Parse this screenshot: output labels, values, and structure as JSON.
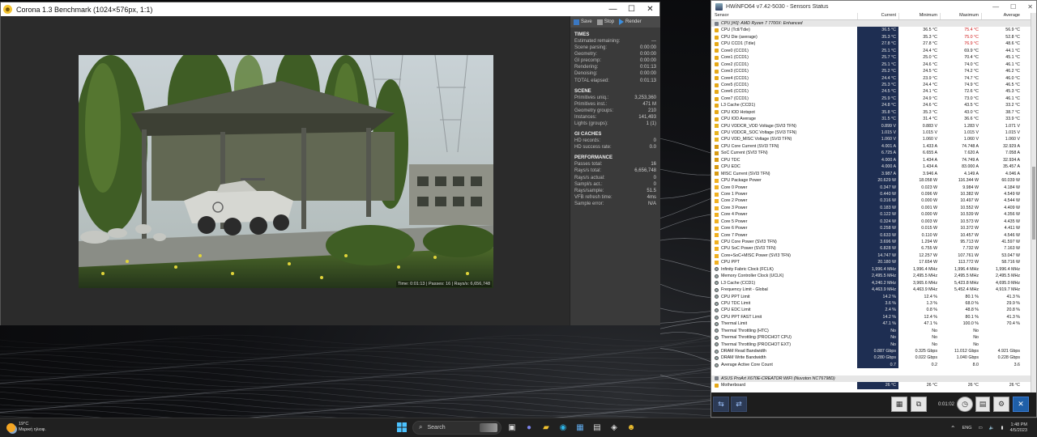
{
  "corona": {
    "title": "Corona 1.3 Benchmark (1024×576px, 1:1)",
    "controls": {
      "min": "—",
      "max": "☐",
      "close": "✕"
    },
    "toolbar": {
      "save": "Save",
      "stop": "Stop",
      "render": "Render"
    },
    "status_overlay": "Time: 0:01:13 | Passes: 16 | Rays/s: 6,656,748",
    "sections": [
      {
        "title": "TIMES",
        "rows": [
          [
            "Estimated remaining:",
            "---"
          ],
          [
            "Scene parsing:",
            "0:00:00"
          ],
          [
            "Geometry:",
            "0:00:00"
          ],
          [
            "GI precomp:",
            "0:00:00"
          ],
          [
            "Rendering:",
            "0:01:13"
          ],
          [
            "Denoising:",
            "0:00:00"
          ],
          [
            "TOTAL elapsed:",
            "0:01:13"
          ]
        ]
      },
      {
        "title": "SCENE",
        "rows": [
          [
            "Primitives uniq.:",
            "3,253,360"
          ],
          [
            "Primitives inst.:",
            "471 M"
          ],
          [
            "Geometry groups:",
            "210"
          ],
          [
            "Instances:",
            "141,493"
          ],
          [
            "Lights (groups):",
            "1 (1)"
          ]
        ]
      },
      {
        "title": "GI CACHES",
        "rows": [
          [
            "HD records:",
            "0"
          ],
          [
            "HD success rate:",
            "0.0"
          ]
        ]
      },
      {
        "title": "PERFORMANCE",
        "rows": [
          [
            "Passes total:",
            "16"
          ],
          [
            "Rays/s total:",
            "6,656,748"
          ],
          [
            "Rays/s actual:",
            "0"
          ],
          [
            "Sampl/s act.:",
            "0"
          ],
          [
            "Rays/sample:",
            "51.5"
          ],
          [
            "VFB refresh time:",
            "4ms"
          ],
          [
            "Sample error:",
            "N/A"
          ]
        ]
      }
    ]
  },
  "hwinfo": {
    "title": "HWiNFO64 v7.42-5030 - Sensors Status",
    "columns": {
      "sensor": "Sensor",
      "current": "Current",
      "minimum": "Minimum",
      "maximum": "Maximum",
      "average": "Average"
    },
    "timer": "0:01:02",
    "rows": [
      {
        "type": "group",
        "name": "CPU [#0]: AMD Ryzen 7 7700X: Enhanced"
      },
      {
        "i": "t",
        "name": "CPU (Tctl/Tdie)",
        "cur": "36.5 °C",
        "min": "36.5 °C",
        "max": "75.4 °C",
        "avg": "56.9 °C",
        "maxred": true
      },
      {
        "i": "t",
        "name": "CPU Die (average)",
        "cur": "35.3 °C",
        "min": "35.3 °C",
        "max": "75.0 °C",
        "avg": "52.8 °C",
        "maxred": true
      },
      {
        "i": "t",
        "name": "CPU CCD1 (Tdie)",
        "cur": "27.8 °C",
        "min": "27.8 °C",
        "max": "76.9 °C",
        "avg": "48.6 °C",
        "maxred": true
      },
      {
        "i": "t",
        "name": "Core0 (CCD1)",
        "cur": "25.1 °C",
        "min": "24.4 °C",
        "max": "69.9 °C",
        "avg": "44.1 °C"
      },
      {
        "i": "t",
        "name": "Core1 (CCD1)",
        "cur": "25.7 °C",
        "min": "25.0 °C",
        "max": "70.4 °C",
        "avg": "45.1 °C"
      },
      {
        "i": "t",
        "name": "Core2 (CCD1)",
        "cur": "25.1 °C",
        "min": "24.6 °C",
        "max": "74.0 °C",
        "avg": "46.1 °C"
      },
      {
        "i": "t",
        "name": "Core3 (CCD1)",
        "cur": "25.2 °C",
        "min": "24.5 °C",
        "max": "74.2 °C",
        "avg": "46.2 °C"
      },
      {
        "i": "t",
        "name": "Core4 (CCD1)",
        "cur": "24.4 °C",
        "min": "23.9 °C",
        "max": "74.7 °C",
        "avg": "46.0 °C"
      },
      {
        "i": "t",
        "name": "Core5 (CCD1)",
        "cur": "25.3 °C",
        "min": "24.4 °C",
        "max": "74.9 °C",
        "avg": "46.5 °C"
      },
      {
        "i": "t",
        "name": "Core6 (CCD1)",
        "cur": "24.5 °C",
        "min": "24.1 °C",
        "max": "72.6 °C",
        "avg": "45.3 °C"
      },
      {
        "i": "t",
        "name": "Core7 (CCD1)",
        "cur": "25.9 °C",
        "min": "24.9 °C",
        "max": "73.0 °C",
        "avg": "46.1 °C"
      },
      {
        "i": "t",
        "name": "L3 Cache (CCD1)",
        "cur": "24.8 °C",
        "min": "24.6 °C",
        "max": "43.5 °C",
        "avg": "33.2 °C"
      },
      {
        "i": "t",
        "name": "CPU IOD Hotspot",
        "cur": "35.8 °C",
        "min": "35.3 °C",
        "max": "43.0 °C",
        "avg": "38.7 °C"
      },
      {
        "i": "t",
        "name": "CPU IOD Average",
        "cur": "31.5 °C",
        "min": "31.4 °C",
        "max": "36.6 °C",
        "avg": "33.9 °C"
      },
      {
        "i": "v",
        "name": "CPU VDDCR_VDD Voltage (SVI3 TFN)",
        "cur": "0.899 V",
        "min": "0.883 V",
        "max": "1.283 V",
        "avg": "1.071 V"
      },
      {
        "i": "v",
        "name": "CPU VDDCR_SOC Voltage (SVI3 TFN)",
        "cur": "1.015 V",
        "min": "1.015 V",
        "max": "1.015 V",
        "avg": "1.015 V"
      },
      {
        "i": "v",
        "name": "CPU VDD_MISC Voltage (SVI3 TFN)",
        "cur": "1.060 V",
        "min": "1.060 V",
        "max": "1.060 V",
        "avg": "1.060 V"
      },
      {
        "i": "c",
        "name": "CPU Core Current (SVI3 TFN)",
        "cur": "4.001 A",
        "min": "1.433 A",
        "max": "74.748 A",
        "avg": "32.929 A"
      },
      {
        "i": "c",
        "name": "SoC Current (SVI3 TFN)",
        "cur": "6.725 A",
        "min": "6.655 A",
        "max": "7.620 A",
        "avg": "7.058 A"
      },
      {
        "i": "c",
        "name": "CPU TDC",
        "cur": "4.000 A",
        "min": "1.434 A",
        "max": "74.749 A",
        "avg": "32.934 A"
      },
      {
        "i": "c",
        "name": "CPU EDC",
        "cur": "4.000 A",
        "min": "1.434 A",
        "max": "83.000 A",
        "avg": "35.457 A"
      },
      {
        "i": "c",
        "name": "MISC Current (SVI3 TFN)",
        "cur": "3.987 A",
        "min": "3.946 A",
        "max": "4.149 A",
        "avg": "4.046 A"
      },
      {
        "i": "p",
        "name": "CPU Package Power",
        "cur": "20.629 W",
        "min": "18.058 W",
        "max": "116.344 W",
        "avg": "60.039 W"
      },
      {
        "i": "p",
        "name": "Core 0 Power",
        "cur": "0.347 W",
        "min": "0.023 W",
        "max": "9.984 W",
        "avg": "4.184 W"
      },
      {
        "i": "p",
        "name": "Core 1 Power",
        "cur": "0.440 W",
        "min": "0.096 W",
        "max": "10.382 W",
        "avg": "4.549 W"
      },
      {
        "i": "p",
        "name": "Core 2 Power",
        "cur": "0.316 W",
        "min": "0.000 W",
        "max": "10.497 W",
        "avg": "4.544 W"
      },
      {
        "i": "p",
        "name": "Core 3 Power",
        "cur": "0.183 W",
        "min": "0.001 W",
        "max": "10.552 W",
        "avg": "4.409 W"
      },
      {
        "i": "p",
        "name": "Core 4 Power",
        "cur": "0.122 W",
        "min": "0.000 W",
        "max": "10.539 W",
        "avg": "4.356 W"
      },
      {
        "i": "p",
        "name": "Core 5 Power",
        "cur": "0.324 W",
        "min": "0.003 W",
        "max": "10.573 W",
        "avg": "4.435 W"
      },
      {
        "i": "p",
        "name": "Core 6 Power",
        "cur": "0.258 W",
        "min": "0.015 W",
        "max": "10.372 W",
        "avg": "4.411 W"
      },
      {
        "i": "p",
        "name": "Core 7 Power",
        "cur": "0.633 W",
        "min": "0.110 W",
        "max": "10.457 W",
        "avg": "4.546 W"
      },
      {
        "i": "p",
        "name": "CPU Core Power (SVI3 TFN)",
        "cur": "3.696 W",
        "min": "1.294 W",
        "max": "95.713 W",
        "avg": "41.597 W"
      },
      {
        "i": "p",
        "name": "CPU SoC Power (SVI3 TFN)",
        "cur": "6.828 W",
        "min": "6.755 W",
        "max": "7.732 W",
        "avg": "7.163 W"
      },
      {
        "i": "p",
        "name": "Core+SoC+MISC Power (SVI3 TFN)",
        "cur": "14.747 W",
        "min": "12.257 W",
        "max": "107.761 W",
        "avg": "53.047 W"
      },
      {
        "i": "p",
        "name": "CPU PPT",
        "cur": "20.180 W",
        "min": "17.654 W",
        "max": "113.772 W",
        "avg": "58.716 W"
      },
      {
        "i": "o",
        "name": "Infinity Fabric Clock (FCLK)",
        "cur": "1,996.4 MHz",
        "min": "1,996.4 MHz",
        "max": "1,996.4 MHz",
        "avg": "1,996.4 MHz"
      },
      {
        "i": "o",
        "name": "Memory Controller Clock (UCLK)",
        "cur": "2,495.5 MHz",
        "min": "2,495.5 MHz",
        "max": "2,495.5 MHz",
        "avg": "2,495.5 MHz"
      },
      {
        "i": "o",
        "name": "L3 Cache (CCD1)",
        "cur": "4,240.2 MHz",
        "min": "3,965.6 MHz",
        "max": "5,423.8 MHz",
        "avg": "4,695.0 MHz"
      },
      {
        "i": "o",
        "name": "Frequency Limit - Global",
        "cur": "4,463.9 MHz",
        "min": "4,463.9 MHz",
        "max": "5,452.4 MHz",
        "avg": "4,919.7 MHz"
      },
      {
        "i": "o",
        "name": "CPU PPT Limit",
        "cur": "14.2 %",
        "min": "12.4 %",
        "max": "80.1 %",
        "avg": "41.3 %"
      },
      {
        "i": "o",
        "name": "CPU TDC Limit",
        "cur": "3.6 %",
        "min": "1.3 %",
        "max": "68.0 %",
        "avg": "29.9 %"
      },
      {
        "i": "o",
        "name": "CPU EDC Limit",
        "cur": "2.4 %",
        "min": "0.8 %",
        "max": "48.8 %",
        "avg": "20.8 %"
      },
      {
        "i": "o",
        "name": "CPU PPT FAST Limit",
        "cur": "14.2 %",
        "min": "12.4 %",
        "max": "80.1 %",
        "avg": "41.3 %"
      },
      {
        "i": "o",
        "name": "Thermal Limit",
        "cur": "47.1 %",
        "min": "47.1 %",
        "max": "100.0 %",
        "avg": "70.4 %"
      },
      {
        "i": "o",
        "name": "Thermal Throttling (HTC)",
        "cur": "No",
        "min": "No",
        "max": "No",
        "avg": ""
      },
      {
        "i": "o",
        "name": "Thermal Throttling (PROCHOT CPU)",
        "cur": "No",
        "min": "No",
        "max": "No",
        "avg": ""
      },
      {
        "i": "o",
        "name": "Thermal Throttling (PROCHOT EXT)",
        "cur": "No",
        "min": "No",
        "max": "No",
        "avg": ""
      },
      {
        "i": "o",
        "name": "DRAM Read Bandwidth",
        "cur": "0.887 Gbps",
        "min": "0.325 Gbps",
        "max": "11.012 Gbps",
        "avg": "4.921 Gbps"
      },
      {
        "i": "o",
        "name": "DRAM Write Bandwidth",
        "cur": "0.280 Gbps",
        "min": "0.022 Gbps",
        "max": "1.040 Gbps",
        "avg": "0.228 Gbps"
      },
      {
        "i": "o",
        "name": "Average Active Core Count",
        "cur": "0.7",
        "min": "0.2",
        "max": "8.0",
        "avg": "3.6"
      },
      {
        "type": "spacer"
      },
      {
        "type": "group",
        "name": "ASUS ProArt X670E-CREATOR WIFI (Nuvoton NCT6798D)"
      },
      {
        "i": "t",
        "name": "Motherboard",
        "cur": "26 °C",
        "min": "26 °C",
        "max": "26 °C",
        "avg": "26 °C"
      }
    ]
  },
  "taskbar": {
    "weather_temp": "19°C",
    "weather_desc": "Μερική ηλιοφ.",
    "search": "Search",
    "lang": "ENG",
    "time": "1:48 PM",
    "date": "4/5/2023"
  },
  "colors": {
    "cur_bg": "#1e2e52",
    "red": "#d01818",
    "accent": "#0078d4"
  }
}
